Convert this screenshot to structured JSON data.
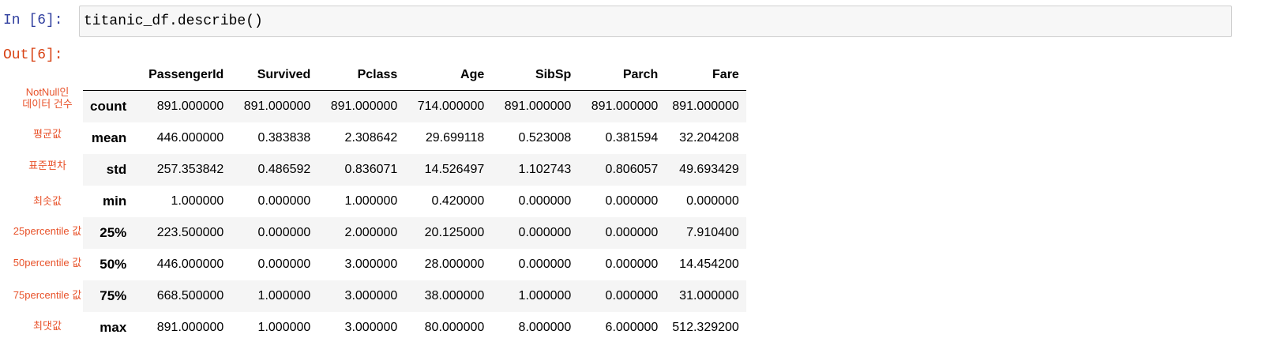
{
  "notebook": {
    "in_prompt": "In [6]:",
    "out_prompt": "Out[6]:",
    "code": "titanic_df.describe()"
  },
  "annotations": [
    {
      "line1": "NotNull인",
      "line2": "데이터 건수"
    },
    {
      "line1": "평균값",
      "line2": ""
    },
    {
      "line1": "표준편차",
      "line2": ""
    },
    {
      "line1": "최솟값",
      "line2": ""
    },
    {
      "line1": "25percentile 값",
      "line2": ""
    },
    {
      "line1": "50percentile 값",
      "line2": ""
    },
    {
      "line1": "75percentile 값",
      "line2": ""
    },
    {
      "line1": "최댓값",
      "line2": ""
    }
  ],
  "table": {
    "columns": [
      "",
      "PassengerId",
      "Survived",
      "Pclass",
      "Age",
      "SibSp",
      "Parch",
      "Fare"
    ],
    "rows": [
      {
        "index": "count",
        "values": [
          "891.000000",
          "891.000000",
          "891.000000",
          "714.000000",
          "891.000000",
          "891.000000",
          "891.000000"
        ]
      },
      {
        "index": "mean",
        "values": [
          "446.000000",
          "0.383838",
          "2.308642",
          "29.699118",
          "0.523008",
          "0.381594",
          "32.204208"
        ]
      },
      {
        "index": "std",
        "values": [
          "257.353842",
          "0.486592",
          "0.836071",
          "14.526497",
          "1.102743",
          "0.806057",
          "49.693429"
        ]
      },
      {
        "index": "min",
        "values": [
          "1.000000",
          "0.000000",
          "1.000000",
          "0.420000",
          "0.000000",
          "0.000000",
          "0.000000"
        ]
      },
      {
        "index": "25%",
        "values": [
          "223.500000",
          "0.000000",
          "2.000000",
          "20.125000",
          "0.000000",
          "0.000000",
          "7.910400"
        ]
      },
      {
        "index": "50%",
        "values": [
          "446.000000",
          "0.000000",
          "3.000000",
          "28.000000",
          "0.000000",
          "0.000000",
          "14.454200"
        ]
      },
      {
        "index": "75%",
        "values": [
          "668.500000",
          "1.000000",
          "3.000000",
          "38.000000",
          "1.000000",
          "0.000000",
          "31.000000"
        ]
      },
      {
        "index": "max",
        "values": [
          "891.000000",
          "1.000000",
          "3.000000",
          "80.000000",
          "8.000000",
          "6.000000",
          "512.329200"
        ]
      }
    ]
  },
  "colors": {
    "in_prompt": "#303f9f",
    "out_prompt": "#d84315",
    "annotation": "#e8522a",
    "stripe": "#f5f5f5"
  }
}
